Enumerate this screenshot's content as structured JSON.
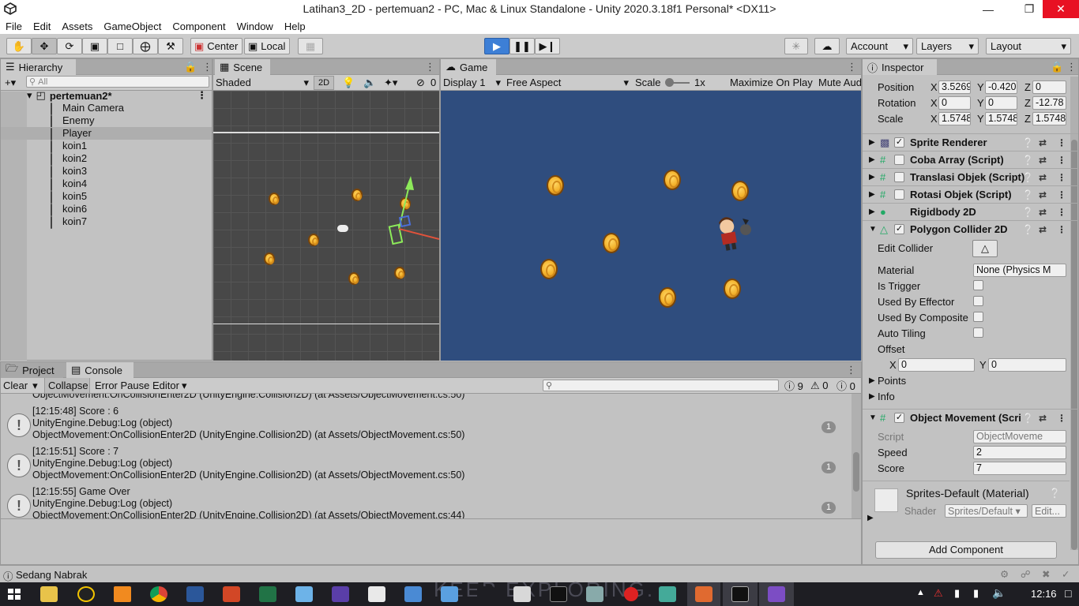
{
  "window": {
    "title": "Latihan3_2D - pertemuan2 - PC, Mac & Linux Standalone - Unity 2020.3.18f1 Personal* <DX11>"
  },
  "menu": [
    "File",
    "Edit",
    "Assets",
    "GameObject",
    "Component",
    "Window",
    "Help"
  ],
  "toolbar": {
    "pivot": "Center",
    "space": "Local",
    "account": "Account",
    "layers": "Layers",
    "layout": "Layout"
  },
  "hierarchy": {
    "tab": "Hierarchy",
    "search_placeholder": "All",
    "scene": "pertemuan2*",
    "items": [
      "Main Camera",
      "Enemy",
      "Player",
      "koin1",
      "koin2",
      "koin3",
      "koin4",
      "koin5",
      "koin6",
      "koin7"
    ],
    "selected": "Player"
  },
  "scene": {
    "tab": "Scene",
    "shading": "Shaded",
    "mode2d": "2D",
    "gizmo_count": "0"
  },
  "game": {
    "tab": "Game",
    "display": "Display 1",
    "aspect": "Free Aspect",
    "scale_label": "Scale",
    "scale_value": "1x",
    "maximize": "Maximize On Play",
    "mute": "Mute Aud"
  },
  "inspector": {
    "tab": "Inspector",
    "transform": {
      "position": {
        "label": "Position",
        "x": "3.5269",
        "y": "-0.420",
        "z": "0"
      },
      "rotation": {
        "label": "Rotation",
        "x": "0",
        "y": "0",
        "z": "-12.78"
      },
      "scale": {
        "label": "Scale",
        "x": "1.5748",
        "y": "1.5748",
        "z": "1.5748"
      }
    },
    "components": [
      {
        "name": "Sprite Renderer",
        "checked": true
      },
      {
        "name": "Coba Array (Script)",
        "checked": false
      },
      {
        "name": "Translasi Objek (Script)",
        "checked": false
      },
      {
        "name": "Rotasi Objek (Script)",
        "checked": false
      },
      {
        "name": "Rigidbody 2D",
        "checked": null
      },
      {
        "name": "Polygon Collider 2D",
        "checked": true
      }
    ],
    "collider": {
      "edit_collider": "Edit Collider",
      "material_label": "Material",
      "material_value": "None (Physics M",
      "is_trigger": "Is Trigger",
      "used_by_effector": "Used By Effector",
      "used_by_composite": "Used By Composite",
      "auto_tiling": "Auto Tiling",
      "offset": "Offset",
      "offset_x_label": "X",
      "offset_x": "0",
      "offset_y_label": "Y",
      "offset_y": "0",
      "points": "Points",
      "info": "Info"
    },
    "object_movement": {
      "name": "Object Movement (Scri",
      "script_label": "Script",
      "script_value": "ObjectMoveme",
      "speed_label": "Speed",
      "speed": "2",
      "score_label": "Score",
      "score": "7"
    },
    "material": {
      "name": "Sprites-Default (Material)",
      "shader_label": "Shader",
      "shader_value": "Sprites/Default",
      "edit": "Edit..."
    },
    "add_component": "Add Component"
  },
  "console": {
    "tabs": {
      "project": "Project",
      "console": "Console"
    },
    "buttons": {
      "clear": "Clear",
      "collapse": "Collapse",
      "error_pause": "Error Pause",
      "editor": "Editor"
    },
    "counts": {
      "log": "9",
      "warn": "0",
      "error": "0"
    },
    "partial_top": "ObjectMovement.OnCollisionEnter2D (UnityEngine.Collision2D) (at Assets/ObjectMovement.cs:50)",
    "entries": [
      {
        "time_msg": "[12:15:48] Score : 6",
        "line2": "UnityEngine.Debug:Log (object)",
        "line3": "ObjectMovement:OnCollisionEnter2D (UnityEngine.Collision2D) (at Assets/ObjectMovement.cs:50)",
        "count": "1"
      },
      {
        "time_msg": "[12:15:51] Score : 7",
        "line2": "UnityEngine.Debug:Log (object)",
        "line3": "ObjectMovement:OnCollisionEnter2D (UnityEngine.Collision2D) (at Assets/ObjectMovement.cs:50)",
        "count": "1"
      },
      {
        "time_msg": "[12:15:55] Game Over",
        "line2": "UnityEngine.Debug:Log (object)",
        "line3": "ObjectMovement:OnCollisionEnter2D (UnityEngine.Collision2D) (at Assets/ObjectMovement.cs:44)",
        "count": "1"
      }
    ]
  },
  "status": {
    "message": "Sedang Nabrak"
  },
  "taskbar": {
    "time": "12:16",
    "wallpaper_text": "KEEP EXPLORING."
  },
  "colors": {
    "game_bg": "#2f4d7e",
    "scene_bg": "#484848",
    "play_blue": "#3d7fd6",
    "panel": "#c2c2c2"
  }
}
